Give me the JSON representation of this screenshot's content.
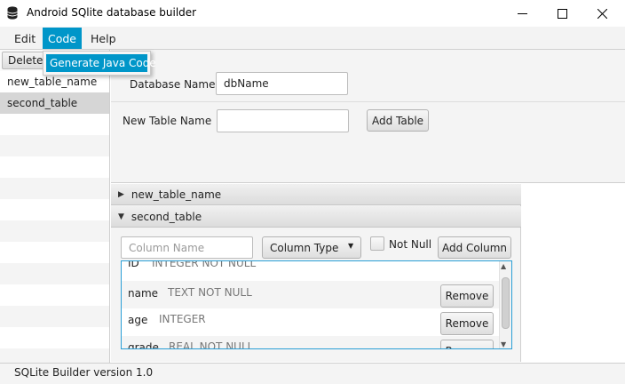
{
  "window": {
    "title": "Android SQlite database builder",
    "icon": "database-icon",
    "controls": [
      "minimize-icon",
      "maximize-icon",
      "close-icon"
    ]
  },
  "menu": {
    "edit": "Edit",
    "code": "Code",
    "help": "Help",
    "code_dropdown": {
      "generate_java": "Generate Java Code"
    }
  },
  "sidebar": {
    "delete_label": "Delete",
    "tables": [
      {
        "label": "new_table_name"
      },
      {
        "label": "second_table"
      }
    ]
  },
  "form": {
    "database_name_label": "Database Name",
    "database_name_value": "dbName",
    "new_table_label": "New Table Name",
    "new_table_value": "",
    "add_table_label": "Add Table"
  },
  "accordion": {
    "panes": [
      {
        "title": "new_table_name",
        "expanded": false
      },
      {
        "title": "second_table",
        "expanded": true
      }
    ]
  },
  "column_form": {
    "column_name_placeholder": "Column Name",
    "column_type_label": "Column Type",
    "not_null_label": "Not Null",
    "not_null_checked": false,
    "add_column_label": "Add Column"
  },
  "columns": [
    {
      "name": "ID",
      "type": "INTEGER NOT NULL",
      "remove_label": "Remove"
    },
    {
      "name": "name",
      "type": "TEXT NOT NULL",
      "remove_label": "Remove"
    },
    {
      "name": "age",
      "type": "INTEGER",
      "remove_label": "Remove"
    },
    {
      "name": "grade",
      "type": "REAL NOT NULL",
      "remove_label": "Remove"
    }
  ],
  "status": {
    "text": "SQLite Builder version 1.0"
  },
  "colors": {
    "accent": "#0096c9",
    "focus_border": "#2a9fd6"
  }
}
